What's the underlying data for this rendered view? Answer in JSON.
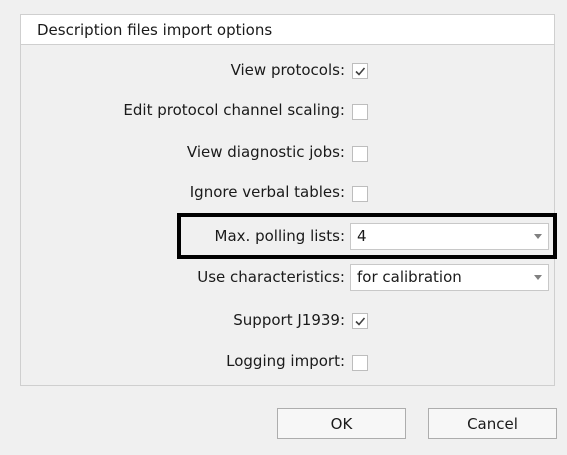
{
  "group": {
    "title": "Description files import options"
  },
  "options": {
    "view_protocols": {
      "label": "View protocols:",
      "checked": true
    },
    "edit_scaling": {
      "label": "Edit protocol channel scaling:",
      "checked": false
    },
    "view_diagnostic": {
      "label": "View diagnostic jobs:",
      "checked": false
    },
    "ignore_verbal": {
      "label": "Ignore verbal tables:",
      "checked": false
    },
    "max_polling": {
      "label": "Max. polling lists:",
      "value": "4"
    },
    "use_characteristics": {
      "label": "Use characteristics:",
      "value": "for calibration"
    },
    "support_j1939": {
      "label": "Support J1939:",
      "checked": true
    },
    "logging_import": {
      "label": "Logging import:",
      "checked": false
    }
  },
  "buttons": {
    "ok": "OK",
    "cancel": "Cancel"
  },
  "colors": {
    "check_mark": "#404040",
    "highlight": "#000000"
  },
  "icons": {
    "checkmark": "checkmark-icon",
    "dropdown": "chevron-down-icon"
  }
}
